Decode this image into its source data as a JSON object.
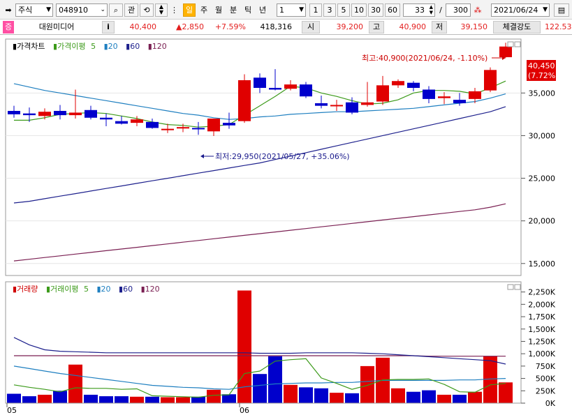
{
  "toolbar": {
    "type_select": "주식",
    "code_input": "048910",
    "watch_label": "관",
    "tabs": [
      "일",
      "주",
      "월",
      "분",
      "틱",
      "년"
    ],
    "interval_select": "1",
    "interval_buttons": [
      "1",
      "3",
      "5",
      "10",
      "30",
      "60"
    ],
    "count_value": "33",
    "slash": "/",
    "total_value": "300",
    "date_value": "2021/06/24"
  },
  "info": {
    "badge": "증",
    "name": "대원미디어",
    "info_btn": "i",
    "price": "40,400",
    "change": "▲2,850",
    "change_pct": "+7.59%",
    "volume": "418,316",
    "open_label": "시",
    "open": "39,200",
    "high_label": "고",
    "high": "40,900",
    "low_label": "저",
    "low": "39,150",
    "strength_label": "체결강도",
    "strength": "122.53"
  },
  "price_legend": {
    "title": "가격차트",
    "ma_label": "가격이평",
    "ma": [
      "5",
      "20",
      "60",
      "120"
    ]
  },
  "volume_legend": {
    "title": "거래량",
    "ma_label": "거래이평",
    "ma": [
      "5",
      "20",
      "60",
      "120"
    ]
  },
  "annotations": {
    "high_note": "최고:40,900(2021/06/24, -1.10%)",
    "low_note": "최저:29,950(2021/05/27, +35.06%)",
    "last_price": "40,450",
    "last_pct": "(7.72%)"
  },
  "x_labels": [
    "05",
    "06"
  ],
  "colors": {
    "up": "#e00000",
    "down": "#0000cc",
    "ma5": "#3c9a1a",
    "ma20": "#1e7fc0",
    "ma60": "#1c1f8c",
    "ma120": "#7a1f52"
  },
  "chart_data": [
    {
      "type": "candlestick",
      "title": "가격차트",
      "y_ticks": [
        "15,000",
        "20,000",
        "25,000",
        "30,000",
        "35,000"
      ],
      "ylim": [
        14000,
        41000
      ],
      "candles": [
        {
          "o": 32900,
          "h": 33500,
          "l": 32100,
          "c": 32500
        },
        {
          "o": 32600,
          "h": 33300,
          "l": 31600,
          "c": 32400
        },
        {
          "o": 32300,
          "h": 33200,
          "l": 31900,
          "c": 32800
        },
        {
          "o": 32900,
          "h": 33600,
          "l": 31900,
          "c": 32400
        },
        {
          "o": 32400,
          "h": 35400,
          "l": 32000,
          "c": 32700
        },
        {
          "o": 33000,
          "h": 33500,
          "l": 31900,
          "c": 32100
        },
        {
          "o": 32100,
          "h": 32600,
          "l": 31100,
          "c": 31900
        },
        {
          "o": 31700,
          "h": 32300,
          "l": 31300,
          "c": 31400
        },
        {
          "o": 31500,
          "h": 32300,
          "l": 31100,
          "c": 31900
        },
        {
          "o": 31600,
          "h": 32000,
          "l": 30800,
          "c": 30900
        },
        {
          "o": 30800,
          "h": 31400,
          "l": 30300,
          "c": 30800
        },
        {
          "o": 30900,
          "h": 31400,
          "l": 30400,
          "c": 31000
        },
        {
          "o": 30900,
          "h": 31600,
          "l": 30100,
          "c": 30800
        },
        {
          "o": 30500,
          "h": 32000,
          "l": 29950,
          "c": 32000
        },
        {
          "o": 31500,
          "h": 32700,
          "l": 30800,
          "c": 31200
        },
        {
          "o": 31700,
          "h": 37200,
          "l": 31500,
          "c": 36500
        },
        {
          "o": 36800,
          "h": 37300,
          "l": 35000,
          "c": 35600
        },
        {
          "o": 35600,
          "h": 37800,
          "l": 35300,
          "c": 35400
        },
        {
          "o": 35500,
          "h": 36500,
          "l": 35300,
          "c": 36000
        },
        {
          "o": 36000,
          "h": 36300,
          "l": 34400,
          "c": 34600
        },
        {
          "o": 33800,
          "h": 34700,
          "l": 33200,
          "c": 33500
        },
        {
          "o": 33500,
          "h": 34200,
          "l": 32900,
          "c": 33600
        },
        {
          "o": 33900,
          "h": 34500,
          "l": 32500,
          "c": 32700
        },
        {
          "o": 33600,
          "h": 36300,
          "l": 33400,
          "c": 33900
        },
        {
          "o": 34000,
          "h": 37000,
          "l": 33600,
          "c": 35900
        },
        {
          "o": 35900,
          "h": 36600,
          "l": 35600,
          "c": 36400
        },
        {
          "o": 36200,
          "h": 36400,
          "l": 35200,
          "c": 35600
        },
        {
          "o": 35400,
          "h": 35800,
          "l": 33800,
          "c": 34300
        },
        {
          "o": 34400,
          "h": 35100,
          "l": 33700,
          "c": 34600
        },
        {
          "o": 34200,
          "h": 35000,
          "l": 33500,
          "c": 33800
        },
        {
          "o": 34300,
          "h": 35600,
          "l": 33800,
          "c": 35200
        },
        {
          "o": 35300,
          "h": 38000,
          "l": 35100,
          "c": 37700
        },
        {
          "o": 39200,
          "h": 40900,
          "l": 39150,
          "c": 40450
        }
      ],
      "ma5": [
        31800,
        31800,
        32100,
        32500,
        32600,
        32700,
        32600,
        32300,
        32000,
        31600,
        31300,
        31200,
        31000,
        31100,
        31300,
        32400,
        33500,
        34600,
        35800,
        35600,
        35000,
        34600,
        34100,
        33700,
        33800,
        34200,
        35000,
        35300,
        35300,
        35200,
        34900,
        35600,
        36400
      ],
      "ma20": [
        36100,
        35700,
        35300,
        35000,
        34700,
        34400,
        34100,
        33800,
        33500,
        33200,
        32900,
        32600,
        32400,
        32100,
        31900,
        32000,
        32200,
        32300,
        32500,
        32600,
        32700,
        32800,
        32800,
        32900,
        33000,
        33100,
        33200,
        33400,
        33600,
        33800,
        34000,
        34400,
        34900
      ],
      "ma60": [
        22100,
        22300,
        22600,
        22900,
        23200,
        23500,
        23800,
        24100,
        24400,
        24700,
        25000,
        25300,
        25600,
        25900,
        26200,
        26500,
        26800,
        27200,
        27600,
        28000,
        28400,
        28800,
        29200,
        29600,
        30000,
        30400,
        30800,
        31200,
        31600,
        32000,
        32400,
        32800,
        33400
      ],
      "ma120": [
        15300,
        15500,
        15700,
        15900,
        16100,
        16300,
        16500,
        16700,
        16900,
        17100,
        17300,
        17500,
        17700,
        17900,
        18100,
        18300,
        18500,
        18700,
        18900,
        19100,
        19300,
        19500,
        19700,
        19900,
        20100,
        20300,
        20500,
        20700,
        20900,
        21100,
        21300,
        21600,
        22000
      ]
    },
    {
      "type": "bar",
      "title": "거래량",
      "y_ticks": [
        "0K",
        "250K",
        "500K",
        "750K",
        "1,000K",
        "1,250K",
        "1,500K",
        "1,750K",
        "2,000K",
        "2,250K"
      ],
      "ylim": [
        0,
        2400000
      ],
      "volumes": [
        190000,
        140000,
        170000,
        250000,
        780000,
        170000,
        140000,
        140000,
        130000,
        130000,
        120000,
        120000,
        130000,
        270000,
        180000,
        2280000,
        590000,
        950000,
        370000,
        320000,
        300000,
        210000,
        200000,
        750000,
        920000,
        300000,
        230000,
        260000,
        170000,
        170000,
        230000,
        950000,
        420000
      ],
      "ma5": [
        370000,
        320000,
        280000,
        230000,
        310000,
        300000,
        300000,
        280000,
        290000,
        150000,
        140000,
        130000,
        120000,
        160000,
        170000,
        600000,
        650000,
        850000,
        880000,
        900000,
        510000,
        400000,
        280000,
        360000,
        470000,
        480000,
        480000,
        490000,
        380000,
        230000,
        220000,
        370000,
        400000
      ],
      "ma20": [
        750000,
        700000,
        650000,
        600000,
        560000,
        520000,
        480000,
        440000,
        400000,
        360000,
        340000,
        320000,
        310000,
        290000,
        280000,
        330000,
        360000,
        390000,
        400000,
        410000,
        410000,
        420000,
        420000,
        440000,
        460000,
        460000,
        460000,
        460000,
        460000,
        470000,
        470000,
        490000,
        500000
      ],
      "ma60": [
        1330000,
        1180000,
        1080000,
        1050000,
        1040000,
        1030000,
        1020000,
        1020000,
        1020000,
        1020000,
        1020000,
        1020000,
        1020000,
        1020000,
        1020000,
        1020000,
        1010000,
        1010000,
        1010000,
        1020000,
        1020000,
        1020000,
        1020000,
        1010000,
        1000000,
        980000,
        960000,
        940000,
        920000,
        900000,
        880000,
        860000,
        790000
      ],
      "ma120": [
        960000,
        960000,
        960000,
        960000,
        960000,
        960000,
        960000,
        960000,
        960000,
        960000,
        960000,
        960000,
        960000,
        960000,
        960000,
        960000,
        960000,
        960000,
        960000,
        960000,
        960000,
        960000,
        960000,
        960000,
        960000,
        960000,
        960000,
        950000,
        950000,
        950000,
        950000,
        950000,
        950000
      ]
    }
  ]
}
